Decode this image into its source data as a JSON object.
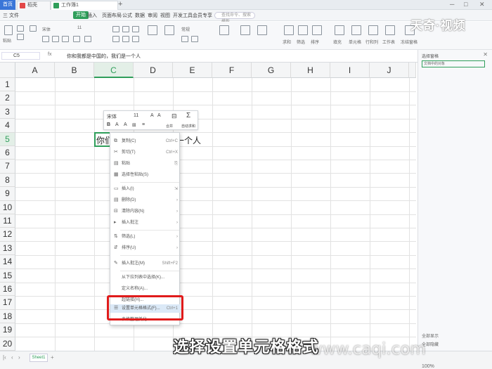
{
  "tabs": {
    "home": "首页",
    "docs": [
      {
        "label": "稻壳",
        "color": "#e34848"
      },
      {
        "label": "工作簿1",
        "color": "#2f9e5a"
      }
    ]
  },
  "menu": {
    "items": [
      "三 文件",
      "开始",
      "插入",
      "页面布局",
      "公式",
      "数据",
      "审阅",
      "视图",
      "开发工具",
      "会员专享",
      "效率"
    ],
    "active_index": 1,
    "search_placeholder": "查找命令、搜索模板"
  },
  "ribbon": {
    "labels": [
      "粘贴",
      "剪切",
      "复制",
      "格式刷",
      "宋体",
      "11",
      "常规",
      "求和",
      "筛选",
      "排序",
      "填充",
      "单元格",
      "行和列",
      "工作表",
      "冻结窗格"
    ]
  },
  "watermark": "天奇·视频",
  "formula_bar": {
    "cell_ref": "C5",
    "fx": "fx",
    "content": "你和我都是中国的，我们是一个人"
  },
  "grid": {
    "columns": [
      "A",
      "B",
      "C",
      "D",
      "E",
      "F",
      "G",
      "H",
      "I",
      "J"
    ],
    "selected_column": "C",
    "rows": [
      "1",
      "2",
      "3",
      "4",
      "5",
      "6",
      "7",
      "8",
      "9",
      "10",
      "11",
      "12",
      "13",
      "14",
      "15",
      "16",
      "17",
      "18",
      "19",
      "20"
    ],
    "selected_row": "5",
    "cell_c5_left": "你们",
    "cell_c5_right": "一个人"
  },
  "mini_toolbar": {
    "font": "宋体",
    "size": "11",
    "sum_label": "自动求和",
    "merge_label": "合并"
  },
  "context_menu": {
    "items": [
      {
        "icon": "⧉",
        "label": "复制(C)",
        "key": "Ctrl+C"
      },
      {
        "icon": "✂",
        "label": "剪切(T)",
        "key": "Ctrl+X"
      },
      {
        "icon": "▤",
        "label": "粘贴",
        "key": "⎘"
      },
      {
        "icon": "▦",
        "label": "选择性粘贴(S)",
        "key": "›"
      },
      {
        "icon": "▭",
        "label": "插入(I)",
        "key": "⇲"
      },
      {
        "icon": "▤",
        "label": "删除(D)",
        "key": "›"
      },
      {
        "icon": "⊟",
        "label": "清除内容(N)",
        "key": "›"
      },
      {
        "icon": "▸",
        "label": "插入批注",
        "key": "›"
      },
      {
        "icon": "⇅",
        "label": "筛选(L)",
        "key": "›"
      },
      {
        "icon": "⇵",
        "label": "排序(U)",
        "key": "›"
      },
      {
        "icon": "✎",
        "label": "插入批注(M)",
        "key": "Shift+F2"
      },
      {
        "icon": "",
        "label": "从下拉列表中选择(K)...",
        "key": ""
      },
      {
        "icon": "",
        "label": "定义名称(A)...",
        "key": ""
      },
      {
        "icon": "",
        "label": "超链接(H)...",
        "key": ""
      },
      {
        "icon": "☰",
        "label": "设置单元格格式(F)...",
        "key": "Ctrl+1"
      },
      {
        "icon": "",
        "label": "表格整理美化",
        "key": ""
      }
    ]
  },
  "panel": {
    "title": "选择窗格",
    "input_hint": "文档中的对象",
    "bottom_labels": [
      "全部显示",
      "全部隐藏"
    ]
  },
  "sheetbar": {
    "sheet_name": "Sheet1",
    "zoom": "100%"
  },
  "caption": "选择设置单元格格式",
  "url_watermark": "www.caqi.com"
}
